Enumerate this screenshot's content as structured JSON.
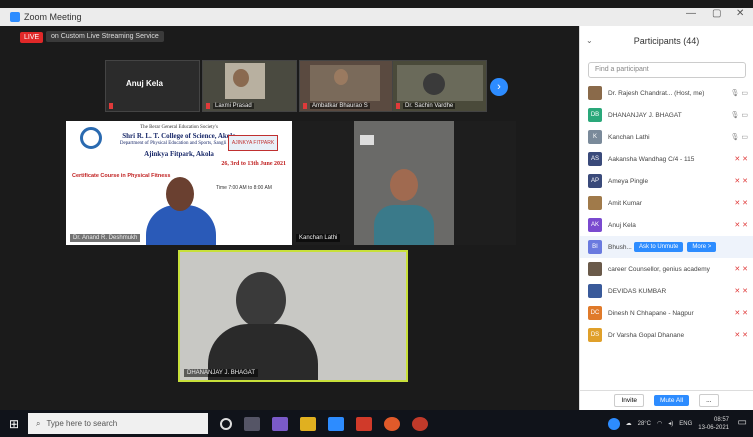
{
  "window": {
    "title": "Zoom Meeting"
  },
  "stage": {
    "live_badge": "LIVE",
    "live_text": "on Custom Live Streaming Service",
    "top_name": "Anuj Kela",
    "thumbs": [
      {
        "label": "Laxmi Prasad"
      },
      {
        "label": "Ambatkar Bhaurao S"
      },
      {
        "label": "Dr. Sachin Vardhe"
      }
    ],
    "slide": {
      "society": "The Berar General Education Society's",
      "college": "Shri R. L. T. College of Science, Akola",
      "dept": "Department of Physical Education and Sports, Sangli Road",
      "sub": "Ajinkya Fitpark, Akola",
      "dates": "26, 3rd to 13th June 2021",
      "course": "Certificate Course in Physical Fitness",
      "time": "Time 7:00 AM to 8:00 AM",
      "logo": "AJINKYA FITPARK",
      "name_label": "Dr. Anand R. Deshmukh"
    },
    "presenter_label": "Kanchan Lathi",
    "active_label": "DHANANJAY J. BHAGAT"
  },
  "participants": {
    "title": "Participants (44)",
    "find_placeholder": "Find a participant",
    "rows": [
      {
        "initials": "",
        "name": "Dr. Rajesh Chandrat... (Host, me)",
        "color": "#8a6a4a",
        "status": "unmuted"
      },
      {
        "initials": "DB",
        "name": "DHANANJAY J. BHAGAT",
        "color": "#2aa87a",
        "status": "unmuted"
      },
      {
        "initials": "K",
        "name": "Kanchan Lathi",
        "color": "#7a8a9a",
        "status": "unmuted"
      },
      {
        "initials": "AS",
        "name": "Aakansha Wandhag C/4 - 115",
        "color": "#3a4a7a",
        "status": "muted"
      },
      {
        "initials": "AP",
        "name": "Ameya Pingle",
        "color": "#3a4a7a",
        "status": "muted"
      },
      {
        "initials": "",
        "name": "Amit Kumar",
        "color": "#a07a4a",
        "status": "muted"
      },
      {
        "initials": "AK",
        "name": "Anuj Kela",
        "color": "#7a4acf",
        "status": "muted"
      },
      {
        "initials": "BI",
        "name": "Bhush...",
        "color": "#6a7adf",
        "status": "hover"
      },
      {
        "initials": "",
        "name": "career Counsellor, genius academy",
        "color": "#6a5a4a",
        "status": "muted"
      },
      {
        "initials": "",
        "name": "DEVIDAS KUMBAR",
        "color": "#3a5a9a",
        "status": "muted"
      },
      {
        "initials": "DC",
        "name": "Dinesh N Chhapane - Nagpur",
        "color": "#e07a2a",
        "status": "muted"
      },
      {
        "initials": "DS",
        "name": "Dr Varsha Gopal Dhanane",
        "color": "#e0a02a",
        "status": "muted"
      }
    ],
    "ask_unmute": "Ask to Unmute",
    "more": "More >",
    "footer": {
      "invite": "Invite",
      "mute_all": "Mute All",
      "dots": "..."
    }
  },
  "taskbar": {
    "search_placeholder": "Type here to search",
    "temp": "28°C",
    "lang": "ENG",
    "time": "08:57",
    "date": "13-06-2021"
  },
  "colors": {
    "zoom_blue": "#2d8cff",
    "muted_red": "#e03a3a",
    "active_border": "#c8e03a"
  }
}
